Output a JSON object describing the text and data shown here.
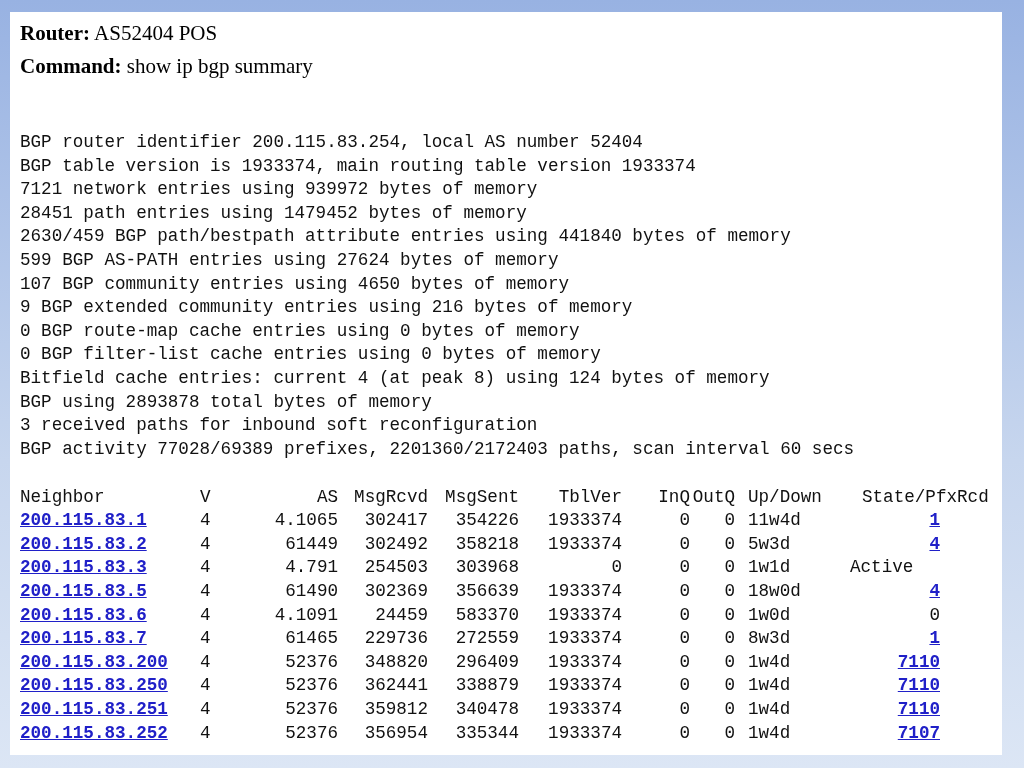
{
  "header": {
    "router": "**Router:** AS52404 POS",
    "command": "**Command:** show ip bgp summary"
  },
  "summary_lines": [
    "BGP router identifier 200.115.83.254, local AS number 52404",
    "BGP table version is 1933374, main routing table version 1933374",
    "7121 network entries using 939972 bytes of memory",
    "28451 path entries using 1479452 bytes of memory",
    "2630/459 BGP path/bestpath attribute entries using 441840 bytes of memory",
    "599 BGP AS-PATH entries using 27624 bytes of memory",
    "107 BGP community entries using 4650 bytes of memory",
    "9 BGP extended community entries using 216 bytes of memory",
    "0 BGP route-map cache entries using 0 bytes of memory",
    "0 BGP filter-list cache entries using 0 bytes of memory",
    "Bitfield cache entries: current 4 (at peak 8) using 124 bytes of memory",
    "BGP using 2893878 total bytes of memory",
    "3 received paths for inbound soft reconfiguration",
    "BGP activity 77028/69389 prefixes, 2201360/2172403 paths, scan interval 60 secs"
  ],
  "table": {
    "columns": [
      "Neighbor",
      "V",
      "AS",
      "MsgRcvd",
      "MsgSent",
      "TblVer",
      "InQ",
      "OutQ",
      "Up/Down",
      "State/PfxRcd"
    ],
    "rows": [
      {
        "neighbor": "200.115.83.1",
        "v": "4",
        "as": "4.1065",
        "msg_rcvd": "302417",
        "msg_sent": "354226",
        "tbl_ver": "1933374",
        "in_q": "0",
        "out_q": "0",
        "up_down": "11w4d",
        "state_pfxrcd": {
          "kind": "count",
          "text": "1",
          "link": true
        }
      },
      {
        "neighbor": "200.115.83.2",
        "v": "4",
        "as": "61449",
        "msg_rcvd": "302492",
        "msg_sent": "358218",
        "tbl_ver": "1933374",
        "in_q": "0",
        "out_q": "0",
        "up_down": "5w3d",
        "state_pfxrcd": {
          "kind": "count",
          "text": "4",
          "link": true
        }
      },
      {
        "neighbor": "200.115.83.3",
        "v": "4",
        "as": "4.791",
        "msg_rcvd": "254503",
        "msg_sent": "303968",
        "tbl_ver": "0",
        "in_q": "0",
        "out_q": "0",
        "up_down": "1w1d",
        "state_pfxrcd": {
          "kind": "state",
          "text": "Active",
          "link": false
        }
      },
      {
        "neighbor": "200.115.83.5",
        "v": "4",
        "as": "61490",
        "msg_rcvd": "302369",
        "msg_sent": "356639",
        "tbl_ver": "1933374",
        "in_q": "0",
        "out_q": "0",
        "up_down": "18w0d",
        "state_pfxrcd": {
          "kind": "count",
          "text": "4",
          "link": true
        }
      },
      {
        "neighbor": "200.115.83.6",
        "v": "4",
        "as": "4.1091",
        "msg_rcvd": "24459",
        "msg_sent": "583370",
        "tbl_ver": "1933374",
        "in_q": "0",
        "out_q": "0",
        "up_down": "1w0d",
        "state_pfxrcd": {
          "kind": "count",
          "text": "0",
          "link": false
        }
      },
      {
        "neighbor": "200.115.83.7",
        "v": "4",
        "as": "61465",
        "msg_rcvd": "229736",
        "msg_sent": "272559",
        "tbl_ver": "1933374",
        "in_q": "0",
        "out_q": "0",
        "up_down": "8w3d",
        "state_pfxrcd": {
          "kind": "count",
          "text": "1",
          "link": true
        }
      },
      {
        "neighbor": "200.115.83.200",
        "v": "4",
        "as": "52376",
        "msg_rcvd": "348820",
        "msg_sent": "296409",
        "tbl_ver": "1933374",
        "in_q": "0",
        "out_q": "0",
        "up_down": "1w4d",
        "state_pfxrcd": {
          "kind": "count",
          "text": "7110",
          "link": true
        }
      },
      {
        "neighbor": "200.115.83.250",
        "v": "4",
        "as": "52376",
        "msg_rcvd": "362441",
        "msg_sent": "338879",
        "tbl_ver": "1933374",
        "in_q": "0",
        "out_q": "0",
        "up_down": "1w4d",
        "state_pfxrcd": {
          "kind": "count",
          "text": "7110",
          "link": true
        }
      },
      {
        "neighbor": "200.115.83.251",
        "v": "4",
        "as": "52376",
        "msg_rcvd": "359812",
        "msg_sent": "340478",
        "tbl_ver": "1933374",
        "in_q": "0",
        "out_q": "0",
        "up_down": "1w4d",
        "state_pfxrcd": {
          "kind": "count",
          "text": "7110",
          "link": true
        }
      },
      {
        "neighbor": "200.115.83.252",
        "v": "4",
        "as": "52376",
        "msg_rcvd": "356954",
        "msg_sent": "335344",
        "tbl_ver": "1933374",
        "in_q": "0",
        "out_q": "0",
        "up_down": "1w4d",
        "state_pfxrcd": {
          "kind": "count",
          "text": "7107",
          "link": true
        }
      }
    ]
  }
}
